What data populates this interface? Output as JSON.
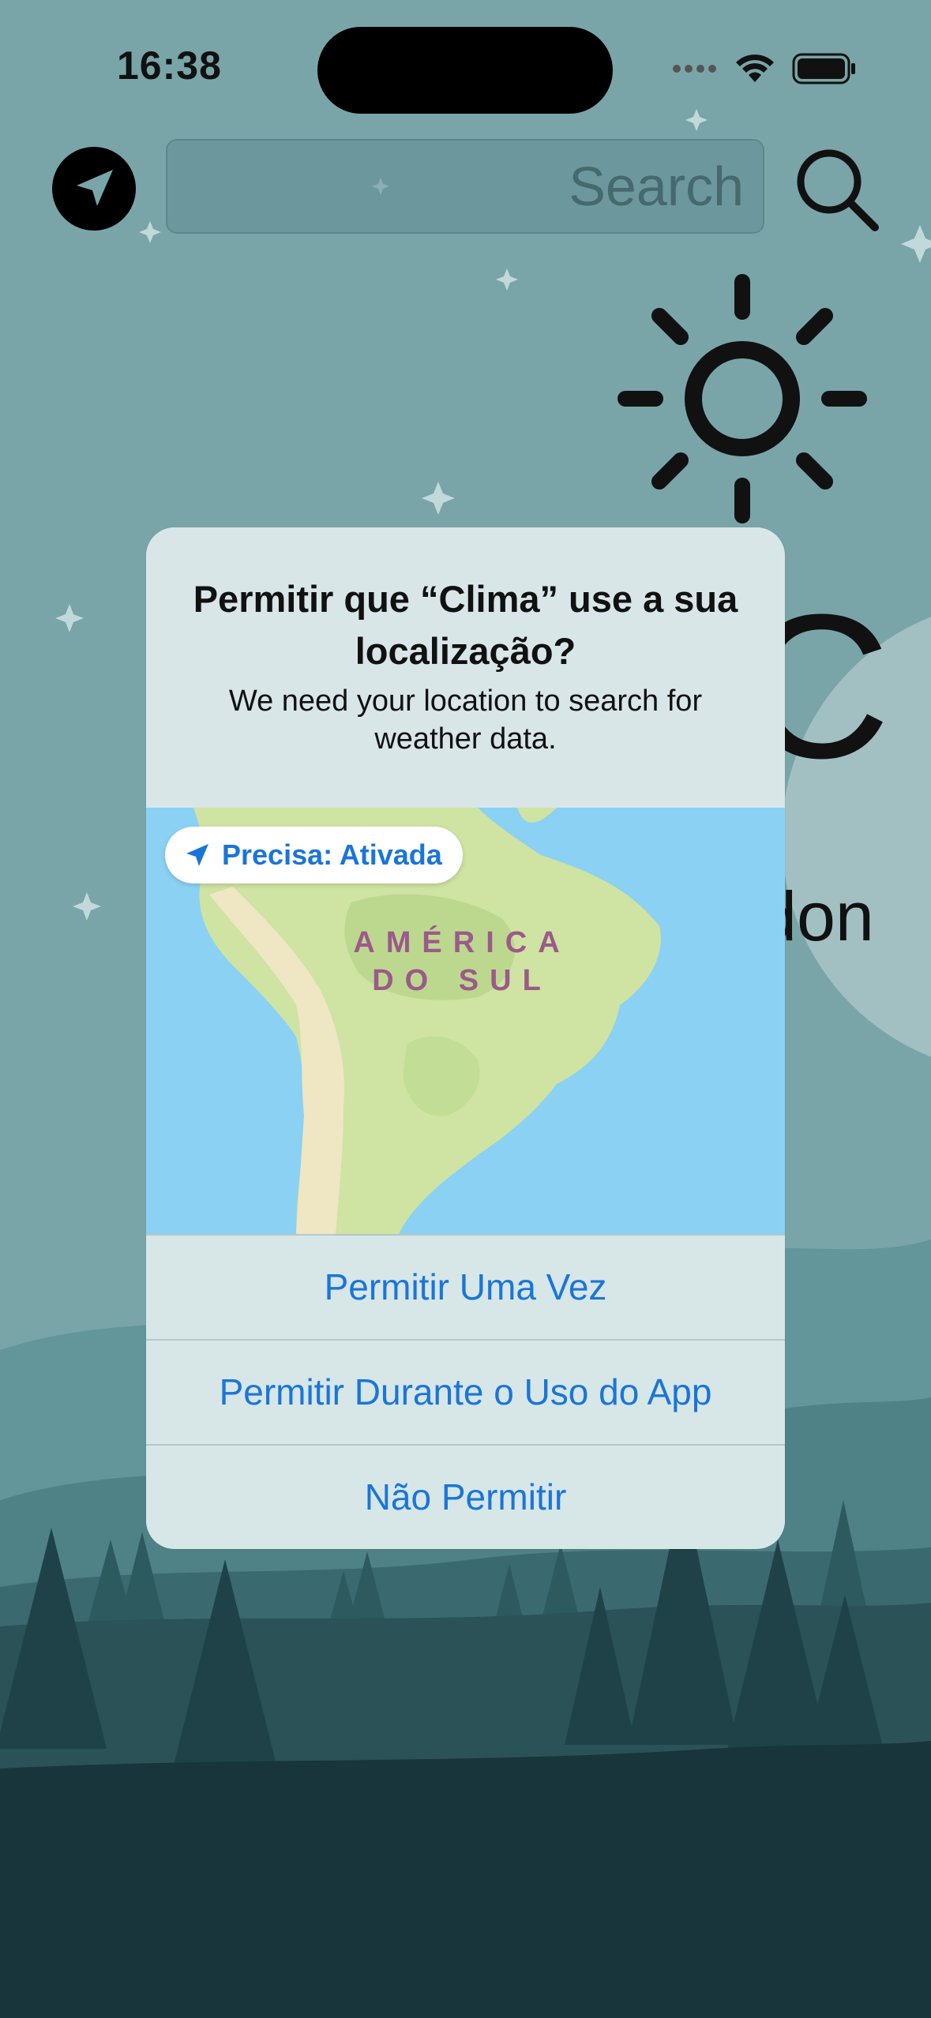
{
  "status_bar": {
    "time": "16:38"
  },
  "search": {
    "placeholder": "Search",
    "value": ""
  },
  "weather": {
    "temperature_partial": "C",
    "city_partial": "don"
  },
  "dialog": {
    "title": "Permitir que “Clima” use a sua localização?",
    "message": "We need your location to search for weather data.",
    "map": {
      "precision_chip": "Precisa: Ativada",
      "region_label_line1": "AMÉRICA",
      "region_label_line2": "DO SUL"
    },
    "buttons": [
      {
        "label": "Permitir Uma Vez"
      },
      {
        "label": "Permitir Durante o Uso do App"
      },
      {
        "label": "Não Permitir"
      }
    ]
  },
  "colors": {
    "sky": "#79a5a8",
    "dialog_bg": "#d7e6e7",
    "accent_blue": "#1a75d9",
    "map_water": "#8bd1f3",
    "map_land": "#cfe3a2",
    "forest_dark": "#17353a"
  },
  "icons": [
    "location-arrow-icon",
    "search-icon",
    "sun-icon",
    "wifi-icon",
    "battery-icon",
    "cellular-dots-icon"
  ]
}
